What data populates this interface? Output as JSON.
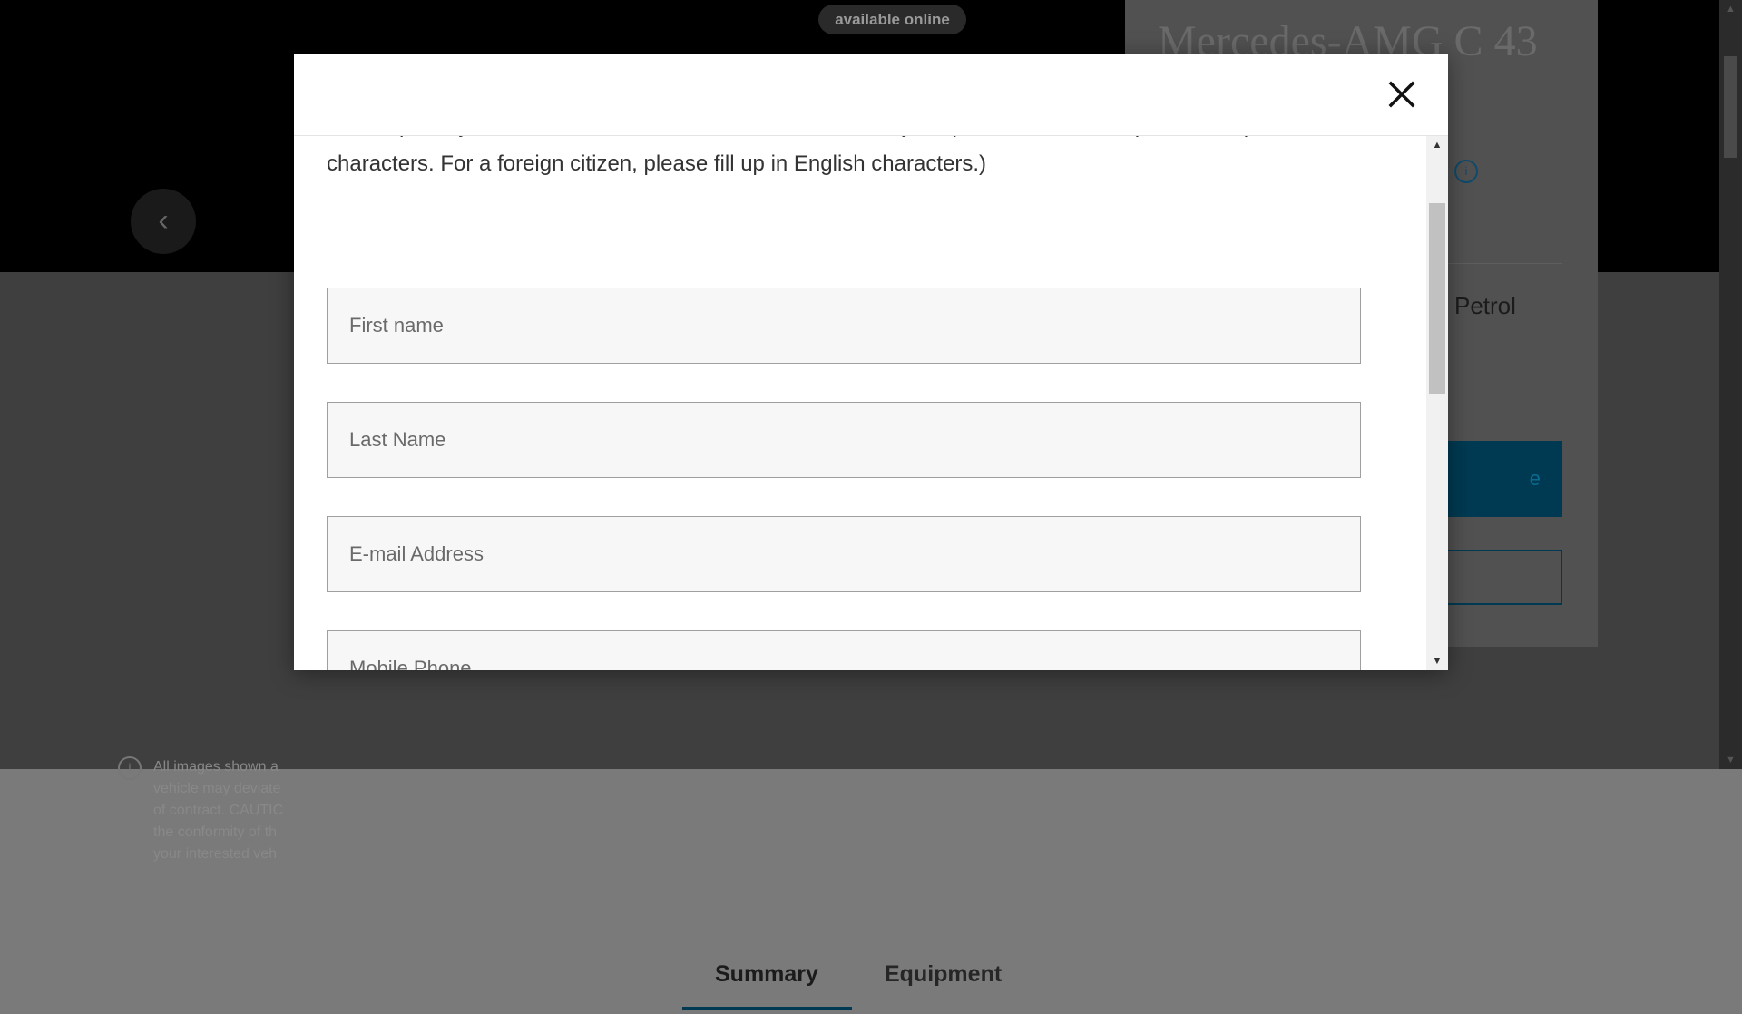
{
  "background": {
    "hero_badge": "available online",
    "prev_icon": "‹",
    "disclaimer": "All images shown a\nvehicle may deviate\nof contract. CAUTIC\nthe conformity of th\nyour interested veh",
    "vehicle_title": "Mercedes-AMG C 43",
    "fuel_type": "Petrol",
    "primary_button_fragment": "e",
    "tabs": {
      "summary": "Summary",
      "equipment": "Equipment"
    }
  },
  "modal": {
    "intro": "Please put in your contact details so the dealer can contact you. (For a Thai citizen, please fill up in Thai characters. For a foreign citizen, please fill up in English characters.)",
    "fields": {
      "first_name": "First name",
      "last_name": "Last Name",
      "email": "E-mail Address",
      "mobile": "Mobile Phone"
    },
    "close_icon": "close-icon"
  },
  "colors": {
    "accent": "#00adef",
    "overlay_page": "#3f3f3f",
    "field_bg": "#f7f7f7"
  }
}
